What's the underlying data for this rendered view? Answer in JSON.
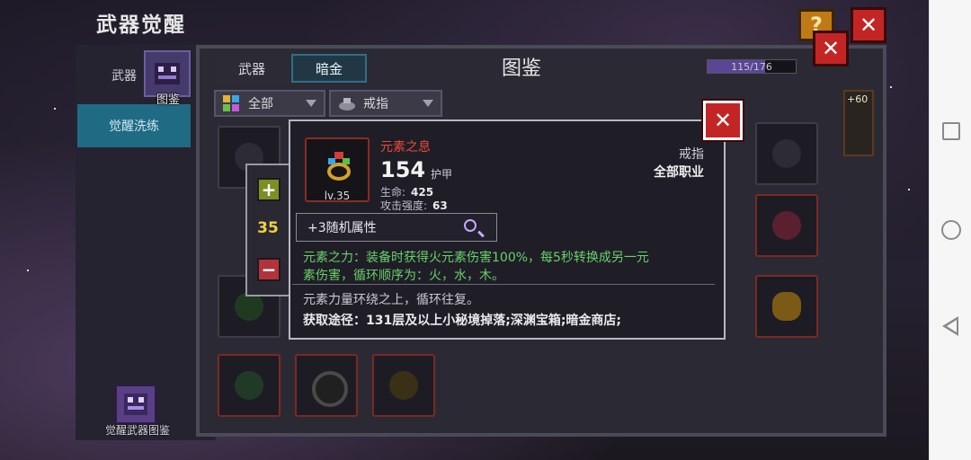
{
  "awaken_window": {
    "title": "武器觉醒",
    "tab_weapon_partial": "武器",
    "tab_awaken_wash": "觉醒洗练",
    "codex_thumb_label": "图鉴",
    "bottom_book_label": "觉醒武器图鉴",
    "help_label": "?"
  },
  "codex": {
    "title": "图鉴",
    "tabs": [
      "武器",
      "暗金"
    ],
    "active_tab": "暗金",
    "progress_text": "115/176",
    "progress_fraction": 0.653,
    "filters": {
      "category": "全部",
      "type": "戒指"
    },
    "corner_badge": "+60"
  },
  "quantity": {
    "value": "35",
    "plus": "+",
    "minus": "−"
  },
  "item": {
    "name": "元素之息",
    "level": "lv.35",
    "armor_value": "154",
    "armor_label": "护甲",
    "stat_hp_label": "生命:",
    "stat_hp_value": "425",
    "stat_atk_label": "攻击强度:",
    "stat_atk_value": "63",
    "type": "戒指",
    "class": "全部职业",
    "random_attr": "+3随机属性",
    "effect_line1": "元素之力：装备时获得火元素伤害100%，每5秒转换成另一元",
    "effect_line2": "素伤害，循环顺序为：火，水，木。",
    "lore": "元素力量环绕之上，循环往复。",
    "source": "获取途径：131层及以上小秘境掉落;深渊宝箱;暗金商店;"
  },
  "colors": {
    "accent_red": "#c32525",
    "effect_green": "#69d06a",
    "name_red": "#e8493a",
    "qty_yellow": "#f2d23a"
  }
}
